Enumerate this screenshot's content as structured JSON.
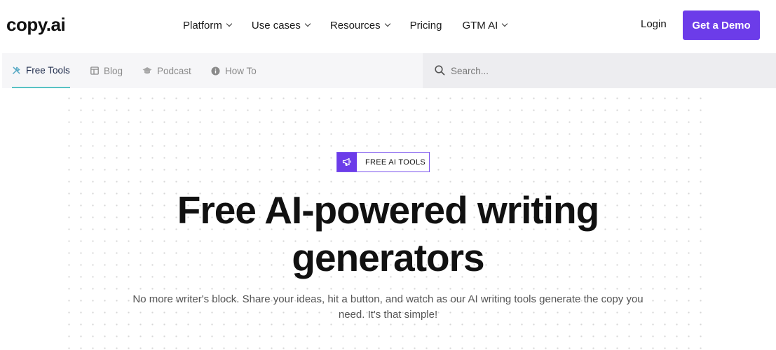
{
  "header": {
    "logo": "copy.ai",
    "nav": [
      {
        "label": "Platform",
        "icon": "chevron-down-icon"
      },
      {
        "label": "Use cases",
        "icon": "chevron-down-icon"
      },
      {
        "label": "Resources",
        "icon": "chevron-down-icon"
      },
      {
        "label": "Pricing"
      },
      {
        "label": "GTM AI",
        "icon": "chevron-down-icon"
      }
    ],
    "login": "Login",
    "demo": "Get a Demo"
  },
  "subnav": {
    "tabs": [
      {
        "label": "Free Tools",
        "icon": "tools-icon",
        "active": true
      },
      {
        "label": "Blog",
        "icon": "blog-icon"
      },
      {
        "label": "Podcast",
        "icon": "graduation-cap-icon"
      },
      {
        "label": "How To",
        "icon": "info-circle-icon"
      }
    ],
    "search": {
      "placeholder": "Search...",
      "value": ""
    }
  },
  "hero": {
    "badge": "FREE AI TOOLS",
    "badge_icon": "megaphone-icon",
    "title_line1": "Free AI-powered writing",
    "title_line2": "generators",
    "subtitle_line1": "No more writer's block. Share your ideas, hit a button, and watch as our AI writing tools generate the copy you",
    "subtitle_line2": "need. It's that simple!"
  },
  "colors": {
    "accent": "#6c3ce9",
    "active_tab_underline": "#57c2c4",
    "subnav_bg": "#f6f6f8",
    "search_bg": "#ededf0"
  }
}
